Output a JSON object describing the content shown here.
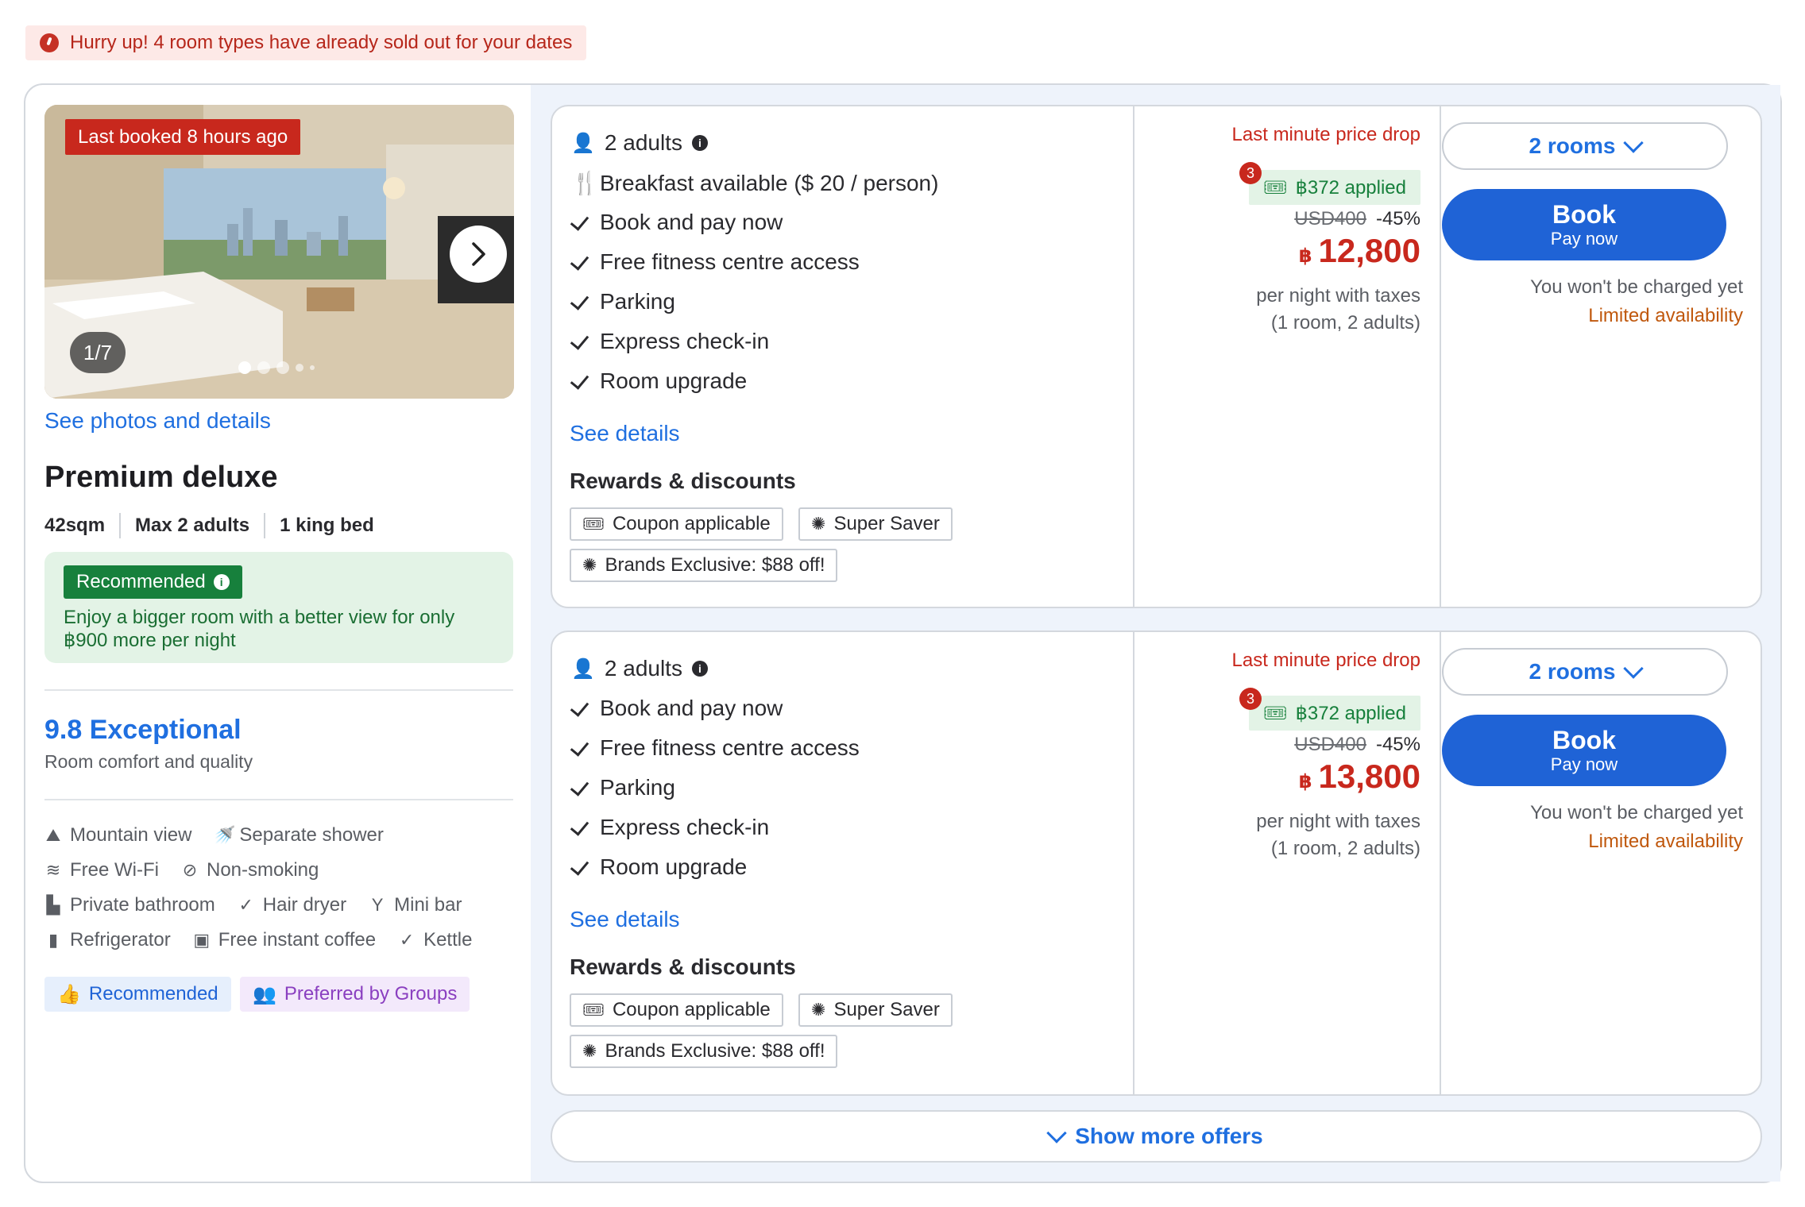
{
  "alert": {
    "text": "Hurry up! 4 room types have already sold out for your dates"
  },
  "room": {
    "photo_badge": "Last booked 8 hours ago",
    "photo_counter": "1/7",
    "see_photos": "See photos and details",
    "name": "Premium deluxe",
    "specs": [
      "42sqm",
      "Max 2 adults",
      "1 king bed"
    ],
    "recommended_badge": "Recommended",
    "recommended_text": "Enjoy a bigger room with a better view for only ฿900 more per night",
    "score": "9.8 Exceptional",
    "score_sub": "Room comfort and quality",
    "amenities": [
      [
        "Mountain view",
        "Separate shower"
      ],
      [
        "Free Wi-Fi",
        "Non-smoking"
      ],
      [
        "Private bathroom",
        "Hair dryer",
        "Mini bar"
      ],
      [
        "Refrigerator",
        "Free instant coffee",
        "Kettle"
      ]
    ],
    "tags": [
      "Recommended",
      "Preferred by Groups"
    ]
  },
  "offers": [
    {
      "occupancy": "2 adults",
      "breakfast": "Breakfast available ($ 20 / person)",
      "features": [
        "Book and pay now",
        "Free fitness centre access",
        "Parking",
        "Express check-in",
        "Room upgrade"
      ],
      "see_details": "See details",
      "rewards_title": "Rewards & discounts",
      "chips": [
        "Coupon applicable",
        "Super Saver",
        "Brands Exclusive: $88 off!"
      ],
      "price_drop": "Last minute price drop",
      "coupon_count": "3",
      "applied": "฿372 applied",
      "orig_price": "USD400",
      "discount": "-45%",
      "currency": "฿",
      "price": "12,800",
      "per_night": "per night with taxes",
      "per_room": "(1 room, 2 adults)",
      "rooms_select": "2 rooms",
      "book": "Book",
      "pay_now": "Pay now",
      "not_charged": "You won't be charged yet",
      "availability": "Limited availability"
    },
    {
      "occupancy": "2 adults",
      "features": [
        "Book and pay now",
        "Free fitness centre access",
        "Parking",
        "Express check-in",
        "Room upgrade"
      ],
      "see_details": "See details",
      "rewards_title": "Rewards & discounts",
      "chips": [
        "Coupon applicable",
        "Super Saver",
        "Brands Exclusive: $88 off!"
      ],
      "price_drop": "Last minute price drop",
      "coupon_count": "3",
      "applied": "฿372 applied",
      "orig_price": "USD400",
      "discount": "-45%",
      "currency": "฿",
      "price": "13,800",
      "per_night": "per night with taxes",
      "per_room": "(1 room, 2 adults)",
      "rooms_select": "2 rooms",
      "book": "Book",
      "pay_now": "Pay now",
      "not_charged": "You won't be charged yet",
      "availability": "Limited availability"
    }
  ],
  "show_more": "Show more offers",
  "colors": {
    "primary": "#1f63d6",
    "link": "#1f6fe0",
    "danger": "#c8281d",
    "success": "#17803c",
    "warning": "#c0580d"
  }
}
